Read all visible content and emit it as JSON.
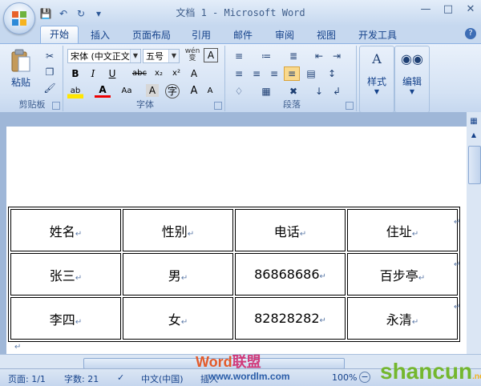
{
  "window": {
    "title": "文档 1 - Microsoft Word",
    "controls": [
      "minimize-icon",
      "maximize-icon",
      "close-icon"
    ]
  },
  "qat": {
    "icons": [
      "save-icon",
      "undo-icon",
      "redo-icon",
      "customize-icon"
    ]
  },
  "tabs": [
    "开始",
    "插入",
    "页面布局",
    "引用",
    "邮件",
    "审阅",
    "视图",
    "开发工具"
  ],
  "active_tab": "开始",
  "ribbon": {
    "clipboard": {
      "label": "剪贴板",
      "paste": "粘贴"
    },
    "font": {
      "label": "字体",
      "font_name": "宋体 (中文正文",
      "font_size": "五号",
      "wen": "wén",
      "a_box": "A",
      "aa": "Aa",
      "a_grow": "A",
      "a_shrink": "A"
    },
    "paragraph": {
      "label": "段落"
    },
    "styles": {
      "label": "样式"
    },
    "editing": {
      "label": "编辑"
    }
  },
  "table": {
    "rows": [
      [
        "姓名",
        "性别",
        "电话",
        "住址"
      ],
      [
        "张三",
        "男",
        "86868686",
        "百步亭"
      ],
      [
        "李四",
        "女",
        "82828282",
        "永清"
      ]
    ]
  },
  "status": {
    "page": "页面: 1/1",
    "words": "字数: 21",
    "language": "中文(中国)",
    "mode": "插入",
    "zoom": "100%"
  },
  "watermark": {
    "word": "Word",
    "lm": "联盟",
    "url": "www.wordlm.com",
    "shancun": "shancun",
    "net": ".net"
  }
}
